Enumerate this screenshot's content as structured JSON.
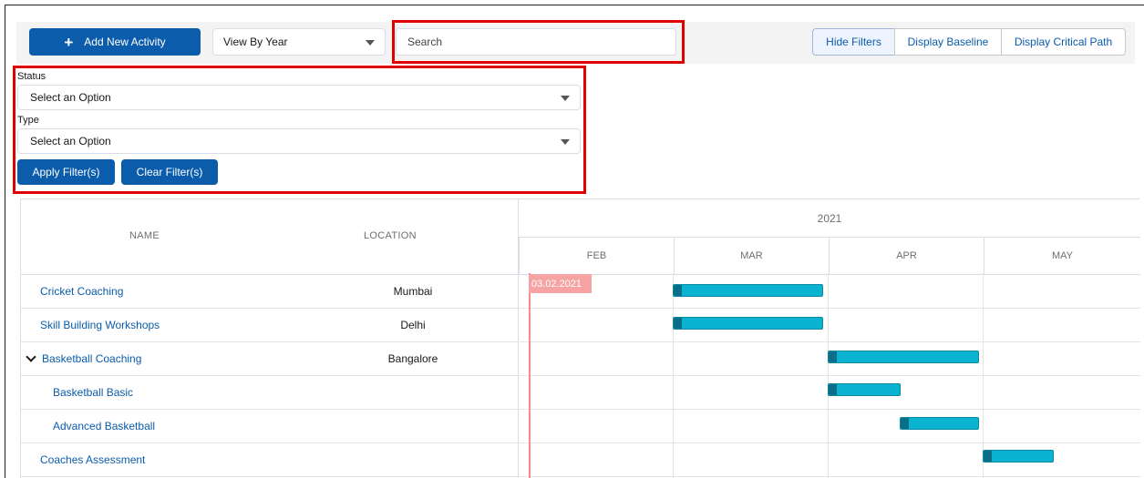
{
  "toolbar": {
    "add_label": "Add New Activity",
    "view_value": "View By Year",
    "search_placeholder": "Search",
    "hide_filters": "Hide Filters",
    "display_baseline": "Display Baseline",
    "display_critical_path": "Display Critical Path"
  },
  "filters": {
    "status_label": "Status",
    "status_value": "Select an Option",
    "type_label": "Type",
    "type_value": "Select an Option",
    "apply_label": "Apply Filter(s)",
    "clear_label": "Clear Filter(s)"
  },
  "grid": {
    "columns": {
      "name": "NAME",
      "location": "LOCATION"
    },
    "year": "2021",
    "months": [
      "FEB",
      "MAR",
      "APR",
      "MAY"
    ],
    "today_label": "03.02.2021",
    "rows": [
      {
        "name": "Cricket Coaching",
        "location": "Mumbai"
      },
      {
        "name": "Skill Building Workshops",
        "location": "Delhi"
      },
      {
        "name": "Basketball Coaching",
        "location": "Bangalore"
      },
      {
        "name": "Basketball Basic",
        "location": ""
      },
      {
        "name": "Advanced Basketball",
        "location": ""
      },
      {
        "name": "Coaches Assessment",
        "location": ""
      }
    ]
  },
  "colors": {
    "accent": "#0b5cab",
    "bar": "#0ab3cf",
    "bar_progress": "#0a6f86",
    "highlight": "#e00000",
    "today": "#f28b8b"
  }
}
